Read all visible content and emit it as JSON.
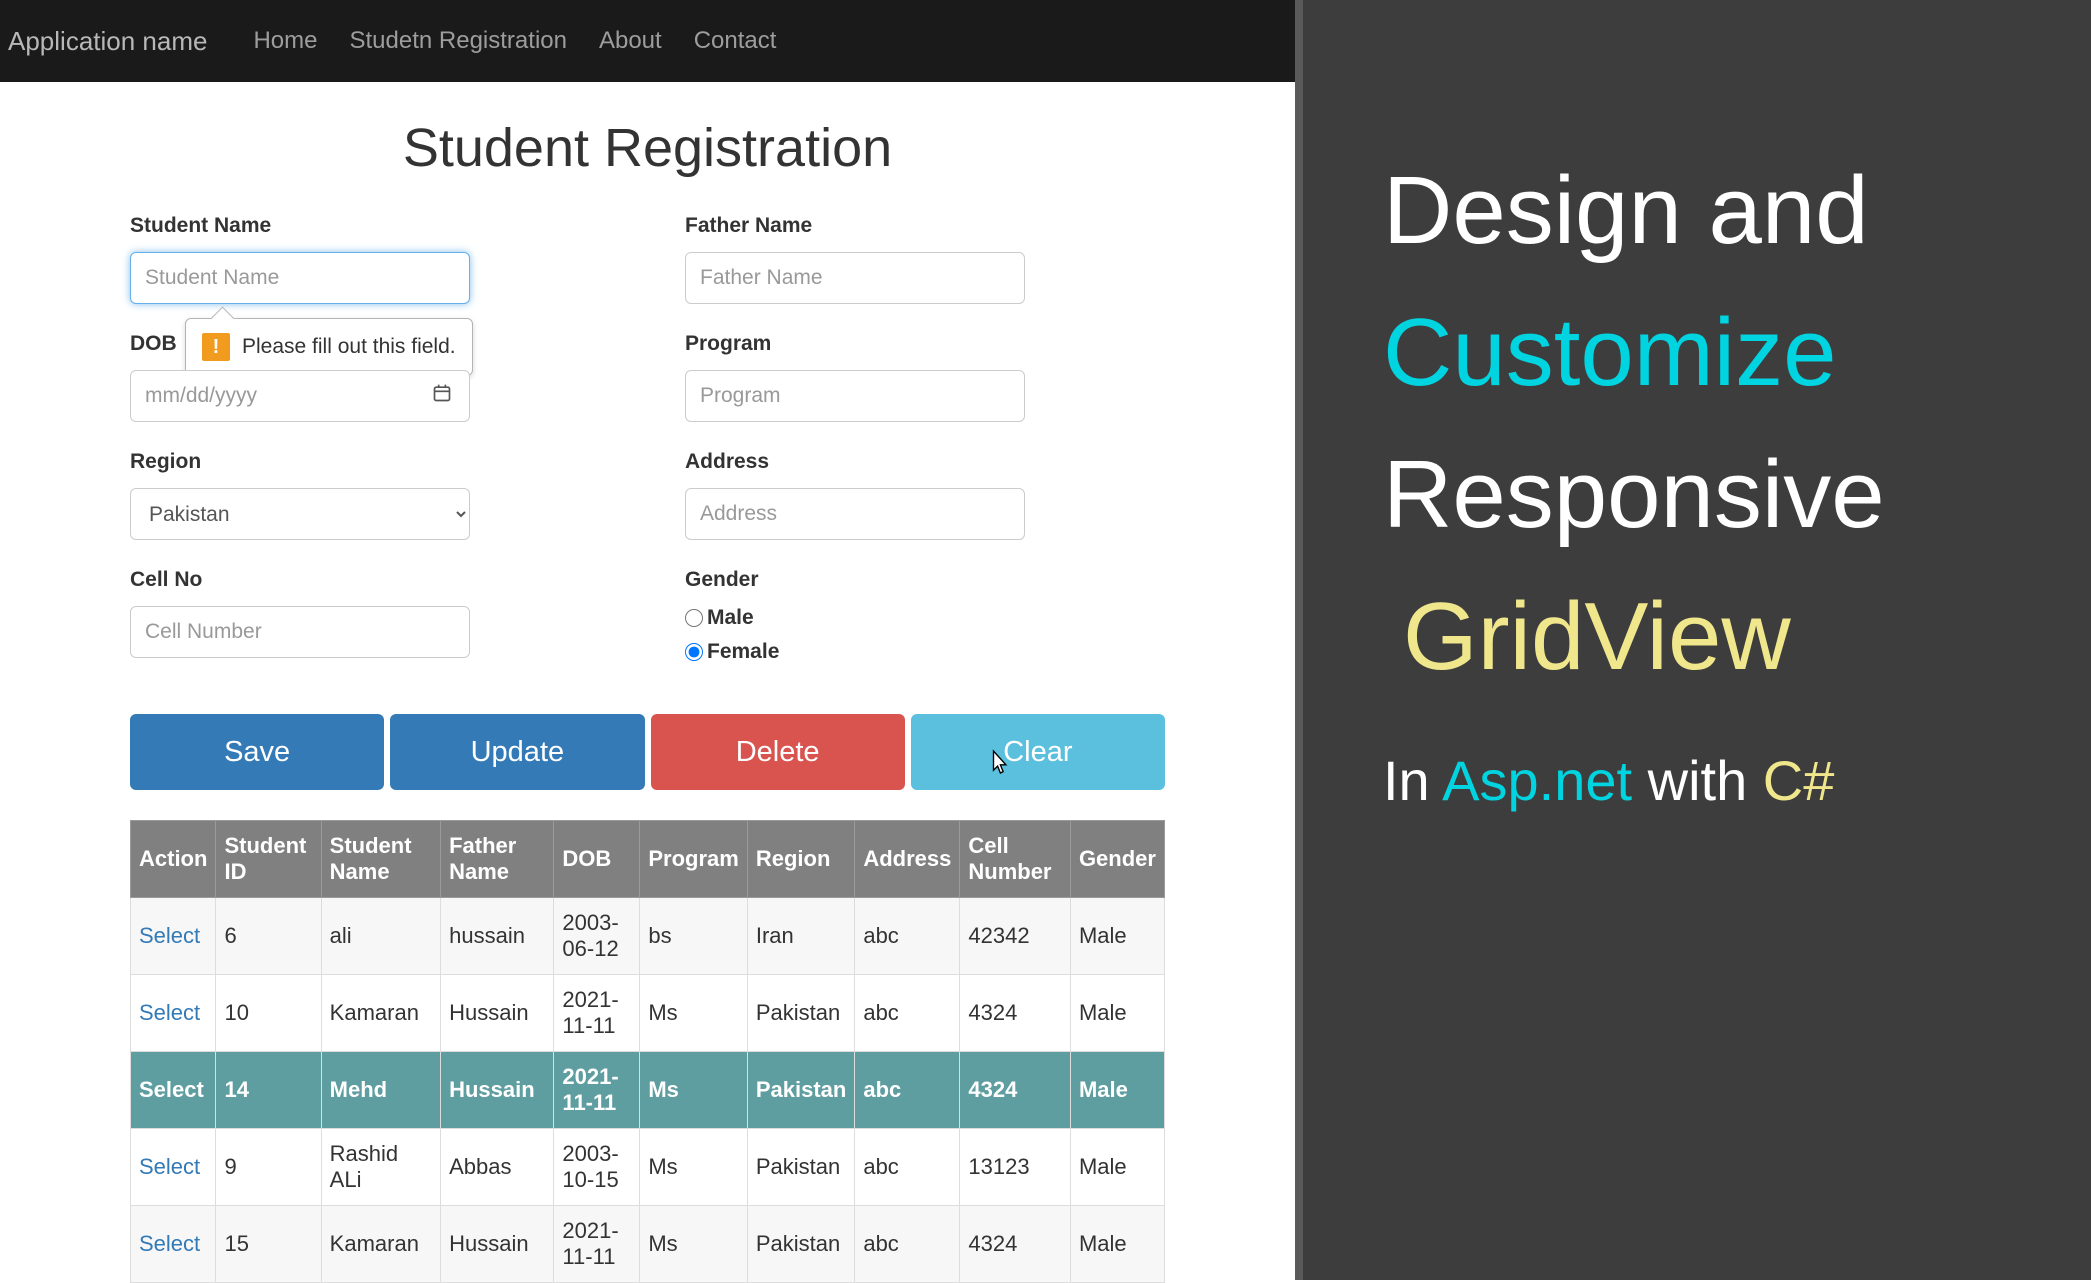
{
  "navbar": {
    "brand": "Application name",
    "items": [
      {
        "label": "Home"
      },
      {
        "label": "Studetn Registration"
      },
      {
        "label": "About"
      },
      {
        "label": "Contact"
      }
    ]
  },
  "page": {
    "title": "Student Registration"
  },
  "form": {
    "student_name": {
      "label": "Student Name",
      "placeholder": "Student Name",
      "value": ""
    },
    "father_name": {
      "label": "Father Name",
      "placeholder": "Father Name",
      "value": ""
    },
    "dob": {
      "label": "DOB",
      "placeholder": "mm/dd/yyyy",
      "value": ""
    },
    "program": {
      "label": "Program",
      "placeholder": "Program",
      "value": ""
    },
    "region": {
      "label": "Region",
      "selected": "Pakistan",
      "options": [
        "Pakistan"
      ]
    },
    "address": {
      "label": "Address",
      "placeholder": "Address",
      "value": ""
    },
    "cell_no": {
      "label": "Cell No",
      "placeholder": "Cell Number",
      "value": ""
    },
    "gender": {
      "label": "Gender",
      "male": "Male",
      "female": "Female",
      "selected": "Female"
    }
  },
  "validation": {
    "message": "Please fill out this field."
  },
  "buttons": {
    "save": "Save",
    "update": "Update",
    "delete": "Delete",
    "clear": "Clear"
  },
  "grid": {
    "headers": [
      "Action",
      "Student ID",
      "Student Name",
      "Father Name",
      "DOB",
      "Program",
      "Region",
      "Address",
      "Cell Number",
      "Gender"
    ],
    "select_label": "Select",
    "rows": [
      {
        "action": "Select",
        "id": "6",
        "name": "ali",
        "father": "hussain",
        "dob": "2003-06-12",
        "program": "bs",
        "region": "Iran",
        "address": "abc",
        "cell": "42342",
        "gender": "Male",
        "selected": false
      },
      {
        "action": "Select",
        "id": "10",
        "name": "Kamaran",
        "father": "Hussain",
        "dob": "2021-11-11",
        "program": "Ms",
        "region": "Pakistan",
        "address": "abc",
        "cell": "4324",
        "gender": "Male",
        "selected": false
      },
      {
        "action": "Select",
        "id": "14",
        "name": "Mehd",
        "father": "Hussain",
        "dob": "2021-11-11",
        "program": "Ms",
        "region": "Pakistan",
        "address": "abc",
        "cell": "4324",
        "gender": "Male",
        "selected": true
      },
      {
        "action": "Select",
        "id": "9",
        "name": "Rashid ALi",
        "father": "Abbas",
        "dob": "2003-10-15",
        "program": "Ms",
        "region": "Pakistan",
        "address": "abc",
        "cell": "13123",
        "gender": "Male",
        "selected": false
      },
      {
        "action": "Select",
        "id": "15",
        "name": "Kamaran",
        "father": "Hussain",
        "dob": "2021-11-11",
        "program": "Ms",
        "region": "Pakistan",
        "address": "abc",
        "cell": "4324",
        "gender": "Male",
        "selected": false
      }
    ]
  },
  "promo": {
    "line1a": "Design and",
    "line2": "Customize",
    "line3": "Responsive",
    "line4": "GridView",
    "sub_in": "In ",
    "sub_asp": "Asp.net",
    "sub_with": " with ",
    "sub_cs": "C#"
  }
}
